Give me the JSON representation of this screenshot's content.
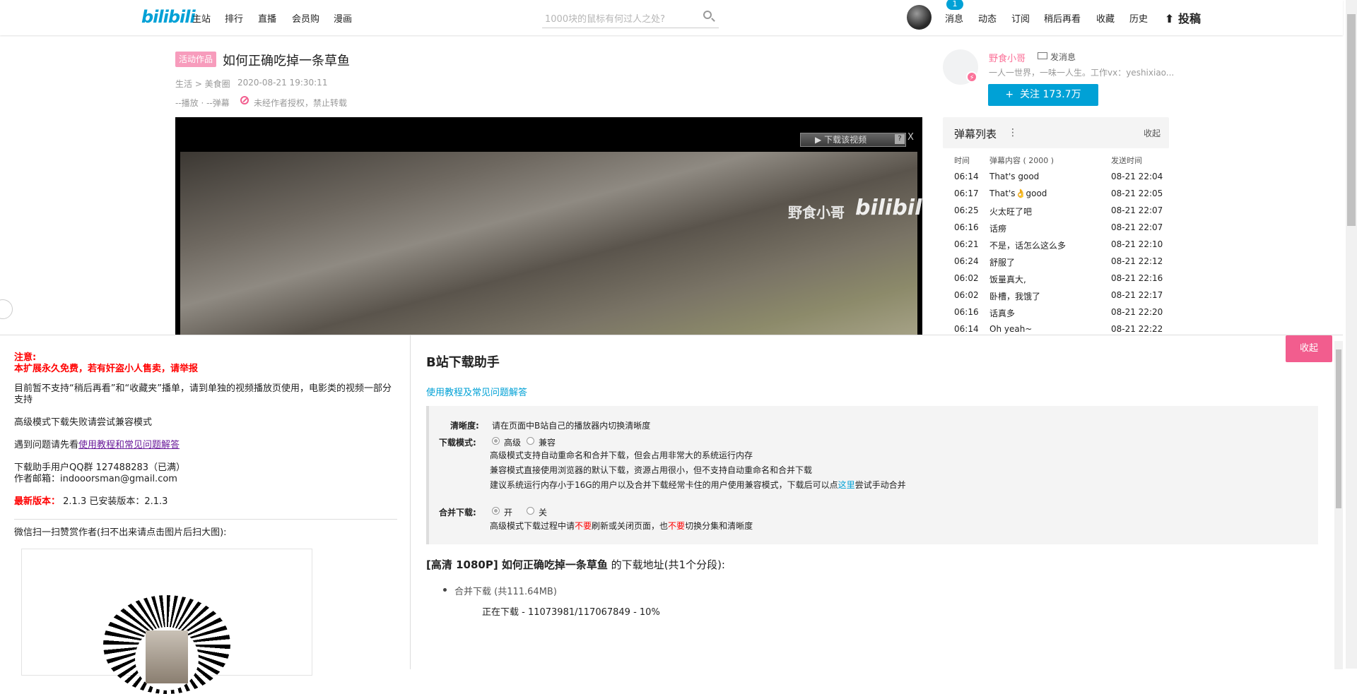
{
  "topbar": {
    "logo": "bilibili",
    "nav": [
      "主站",
      "排行",
      "直播",
      "会员购",
      "漫画"
    ],
    "search_placeholder": "1000块的鼠标有何过人之处?",
    "right_nav": [
      "消息",
      "动态",
      "订阅",
      "稍后再看",
      "收藏",
      "历史"
    ],
    "message_badge": "1",
    "upload": "投稿"
  },
  "video": {
    "tag": "活动作品",
    "title": "如何正确吃掉一条草鱼",
    "category": "生活 > 美食圈",
    "date": "2020-08-21 19:30:11",
    "stats": "--播放 · --弹幕",
    "copyright": "未经作者授权，禁止转载",
    "flash_download": "下载该视频",
    "flash_q": "?",
    "flash_close": "X",
    "watermark_text": "野食小哥",
    "watermark_logo": "bilibili"
  },
  "uploader": {
    "name": "野食小哥",
    "message": "发消息",
    "sign": "一人一世界，一味一人生。工作vx：yeshixiao...",
    "follow": "关注 173.7万",
    "follow_plus": "+"
  },
  "danmaku": {
    "title": "弹幕列表",
    "more": "⋮",
    "collapse": "收起",
    "headers": [
      "时间",
      "弹幕内容 ( 2000 )",
      "发送时间"
    ],
    "rows": [
      [
        "06:14",
        "That's good",
        "08-21 22:04"
      ],
      [
        "06:17",
        "That's👌good",
        "08-21 22:05"
      ],
      [
        "06:25",
        "火太旺了吧",
        "08-21 22:07"
      ],
      [
        "06:16",
        "话痨",
        "08-21 22:07"
      ],
      [
        "06:21",
        "不是，话怎么这么多",
        "08-21 22:10"
      ],
      [
        "06:24",
        "舒服了",
        "08-21 22:12"
      ],
      [
        "06:02",
        "饭量真大,",
        "08-21 22:16"
      ],
      [
        "06:02",
        "卧槽，我饿了",
        "08-21 22:17"
      ],
      [
        "06:16",
        "话真多",
        "08-21 22:20"
      ],
      [
        "06:14",
        "Oh yeah~",
        "08-21 22:22"
      ]
    ]
  },
  "helper_left": {
    "notice_label": "注意:",
    "notice_text": "本扩展永久免费，若有奸盗小人售卖，请举报",
    "p1": "目前暂不支持“稍后再看”和“收藏夹”播单，请到单独的视频播放页使用，电影类的视频一部分支持",
    "p2": "高级模式下载失败请尝试兼容模式",
    "p3_prefix": "遇到问题请先看",
    "p3_link": "使用教程和常见问题解答",
    "qq": "下载助手用户QQ群 127488283（已满）",
    "email": "作者邮箱：indooorsman@gmail.com",
    "version_label": "最新版本：",
    "version_text": "2.1.3 已安装版本：2.1.3",
    "wechat": "微信扫一扫赞赏作者(扫不出来请点击图片后扫大图):"
  },
  "helper_main": {
    "title": "B站下载助手",
    "help_link": "使用教程及常见问题解答",
    "collapse": "收起",
    "quality_label": "清晰度:",
    "quality_text": "请在页面中B站自己的播放器内切换清晰度",
    "mode_label": "下载模式:",
    "mode_options": [
      "高级",
      "兼容"
    ],
    "mode_desc1": "高级模式支持自动重命名和合并下载，但会占用非常大的系统运行内存",
    "mode_desc2": "兼容模式直接使用浏览器的默认下载，资源占用很小，但不支持自动重命名和合并下载",
    "mode_desc3_prefix": "建议系统运行内存小于16G的用户以及合并下载经常卡住的用户使用兼容模式，下载后可以点",
    "mode_desc3_link": "这里",
    "mode_desc3_suffix": "尝试手动合并",
    "merge_label": "合并下载:",
    "merge_options": [
      "开",
      "关"
    ],
    "merge_desc_a": "高级模式下载过程中请",
    "merge_desc_b": "不要",
    "merge_desc_c": "刷新或关闭页面，也",
    "merge_desc_d": "不要",
    "merge_desc_e": "切换分集和清晰度",
    "download_heading_bold": "[高清 1080P] 如何正确吃掉一条草鱼",
    "download_heading_rest": " 的下载地址(共1个分段):",
    "item_label": "合并下载",
    "item_size": " (共111.64MB)",
    "progress_text": "正在下载 - 11073981/117067849 - 10%"
  }
}
